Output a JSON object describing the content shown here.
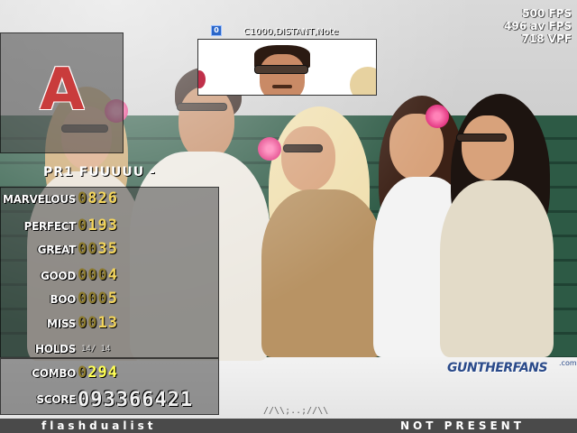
{
  "header": {
    "difficulty_badge": "0",
    "modifiers": "C1000,DISTANT,Note",
    "fps_lines": [
      "500 FPS",
      "496 av FPS",
      "718 VPF"
    ]
  },
  "result": {
    "grade": "A",
    "player_name": "PR1 FUUUUU -",
    "judgments": [
      {
        "label": "MARVELOUS",
        "dim": "0",
        "value": "826"
      },
      {
        "label": "PERFECT",
        "dim": "0",
        "value": "193"
      },
      {
        "label": "GREAT",
        "dim": "00",
        "value": "35"
      },
      {
        "label": "GOOD",
        "dim": "000",
        "value": "4"
      },
      {
        "label": "BOO",
        "dim": "000",
        "value": "5"
      },
      {
        "label": "MISS",
        "dim": "00",
        "value": "13"
      }
    ],
    "holds_label": "HOLDS",
    "holds_value": "14/ 14",
    "combo_label": "COMBO",
    "combo_dim": "0",
    "combo_value": "294",
    "score_label": "SCORE",
    "score_value": "093366421"
  },
  "background": {
    "watermark": "GUNTHERFANS",
    "watermark_suffix": ".com",
    "center_glyphs": "//\\\\;..;//\\\\"
  },
  "footer": {
    "player1": "flashdualist",
    "player2": "NOT PRESENT"
  }
}
